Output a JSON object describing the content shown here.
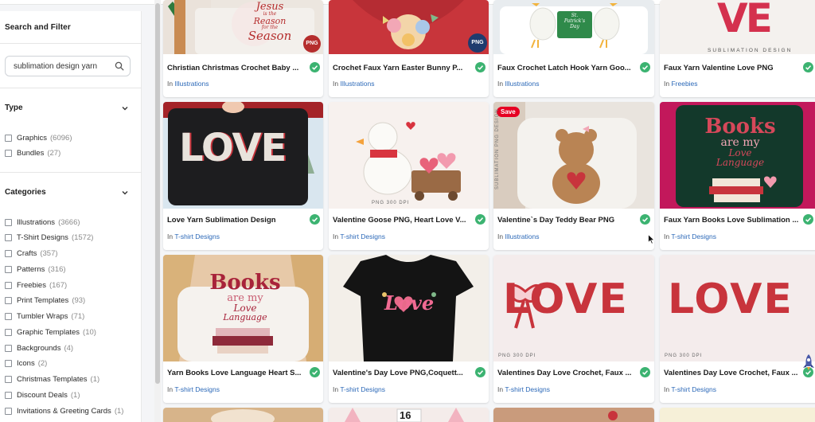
{
  "sidebar": {
    "title": "Search and Filter",
    "search": {
      "value": "sublimation design yarn",
      "placeholder": ""
    },
    "type_section": {
      "heading": "Type",
      "options": [
        {
          "label": "Graphics",
          "count": "(6096)"
        },
        {
          "label": "Bundles",
          "count": "(27)"
        }
      ]
    },
    "categories_section": {
      "heading": "Categories",
      "options": [
        {
          "label": "Illustrations",
          "count": "(3666)"
        },
        {
          "label": "T-Shirt Designs",
          "count": "(1572)"
        },
        {
          "label": "Crafts",
          "count": "(357)"
        },
        {
          "label": "Patterns",
          "count": "(316)"
        },
        {
          "label": "Freebies",
          "count": "(167)"
        },
        {
          "label": "Print Templates",
          "count": "(93)"
        },
        {
          "label": "Tumbler Wraps",
          "count": "(71)"
        },
        {
          "label": "Graphic Templates",
          "count": "(10)"
        },
        {
          "label": "Backgrounds",
          "count": "(4)"
        },
        {
          "label": "Icons",
          "count": "(2)"
        },
        {
          "label": "Christmas Templates",
          "count": "(1)"
        },
        {
          "label": "Discount Deals",
          "count": "(1)"
        },
        {
          "label": "Invitations & Greeting Cards",
          "count": "(1)"
        }
      ]
    }
  },
  "products": [
    {
      "title": "Christian Christmas Crochet Baby ...",
      "prefix": "In",
      "category": "Illustrations"
    },
    {
      "title": "Crochet Faux Yarn Easter Bunny P...",
      "prefix": "In",
      "category": "Illustrations"
    },
    {
      "title": "Faux Crochet Latch Hook Yarn Goo...",
      "prefix": "In",
      "category": "Illustrations"
    },
    {
      "title": "Faux Yarn Valentine Love PNG",
      "prefix": "In",
      "category": "Freebies"
    },
    {
      "title": "Love Yarn Sublimation Design",
      "prefix": "In",
      "category": "T-shirt Designs"
    },
    {
      "title": "Valentine Goose PNG, Heart Love V...",
      "prefix": "In",
      "category": "T-shirt Designs"
    },
    {
      "title": "Valentine`s Day Teddy Bear PNG",
      "prefix": "In",
      "category": "Illustrations"
    },
    {
      "title": "Faux Yarn Books Love Sublimation ...",
      "prefix": "In",
      "category": "T-shirt Designs"
    },
    {
      "title": "Yarn Books Love Language Heart S...",
      "prefix": "In",
      "category": "T-shirt Designs"
    },
    {
      "title": "Valentine's Day Love PNG,Coquett...",
      "prefix": "In",
      "category": "T-shirt Designs"
    },
    {
      "title": "Valentines Day Love Crochet, Faux ...",
      "prefix": "In",
      "category": "T-shirt Designs"
    },
    {
      "title": "Valentines Day Love Crochet, Faux ...",
      "prefix": "In",
      "category": "T-shirt Designs"
    }
  ],
  "image_text": {
    "jesus_line1": "Jesus",
    "jesus_line2": "is the",
    "jesus_line3": "Reason",
    "jesus_line4": "for the",
    "jesus_line5": "Season",
    "png_badge": "PNG",
    "st_patricks_1": "St.",
    "st_patricks_2": "Patrick's",
    "st_patricks_3": "Day",
    "ve_letters": "VE",
    "sublimation_design": "SUBLIMATION DESIGN",
    "sublimation_png_design": "SUBLIMATION PNG DESIGN",
    "love_word": "LOVE",
    "png_300_dpi": "PNG 300 DPI",
    "save_badge": "Save",
    "books_word": "Books",
    "are_my": "are my",
    "love_language_1": "Love",
    "love_language_2": "Language",
    "love_script": "Love",
    "number_16": "16"
  },
  "colors": {
    "link": "#2c69b8",
    "check": "#3cb371",
    "save_badge": "#e60023"
  },
  "icons": [
    "search-icon",
    "chevron-down-icon",
    "check-circle-icon",
    "mouse-cursor-icon",
    "rocket-icon"
  ]
}
